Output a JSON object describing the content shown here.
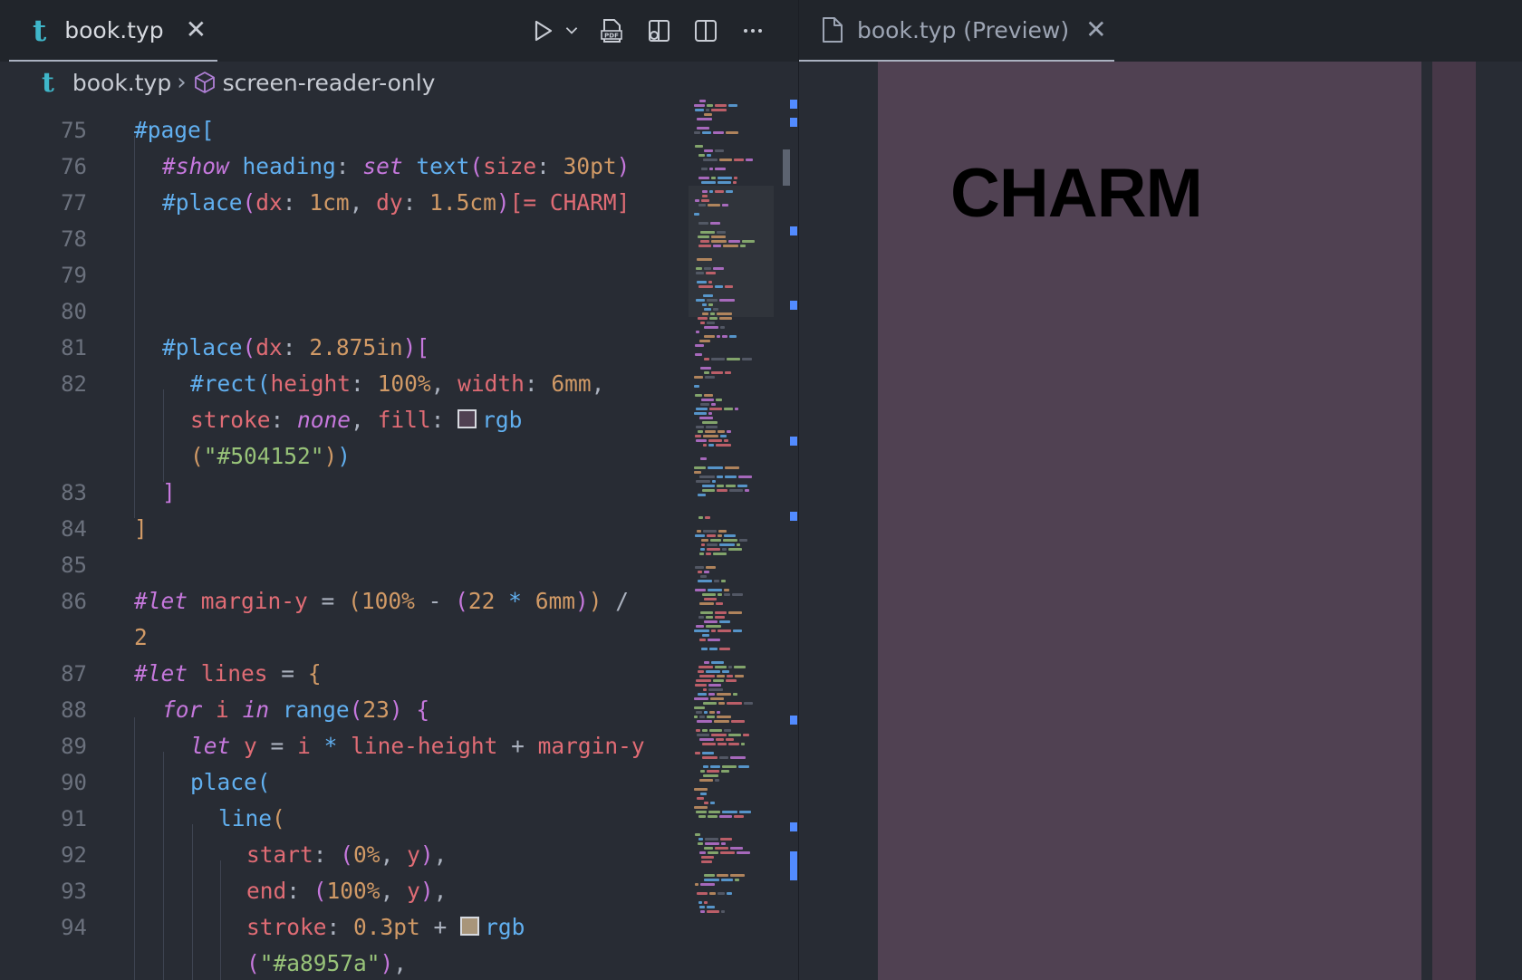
{
  "editor_tab": {
    "icon": "typst-t-icon",
    "logo": "t",
    "title": "book.typ"
  },
  "preview_tab": {
    "title": "book.typ (Preview)"
  },
  "breadcrumb": {
    "logo": "t",
    "file": "book.typ",
    "symbol": "screen-reader-only"
  },
  "toolbar": [
    "run-icon",
    "chevron-down-icon",
    "export-pdf-icon",
    "open-preview-icon",
    "split-editor-icon",
    "more-icon"
  ],
  "preview": {
    "heading_text": "CHARM",
    "page_color": "#504152"
  },
  "code_lines": [
    {
      "n": "75"
    },
    {
      "n": "76"
    },
    {
      "n": "77"
    },
    {
      "n": "78"
    },
    {
      "n": "79"
    },
    {
      "n": "80"
    },
    {
      "n": "81"
    },
    {
      "n": "82"
    },
    {
      "n": ""
    },
    {
      "n": ""
    },
    {
      "n": "83"
    },
    {
      "n": "84"
    },
    {
      "n": "85"
    },
    {
      "n": "86"
    },
    {
      "n": ""
    },
    {
      "n": "87"
    },
    {
      "n": "88"
    },
    {
      "n": "89"
    },
    {
      "n": "90"
    },
    {
      "n": "91"
    },
    {
      "n": "92"
    },
    {
      "n": "93"
    },
    {
      "n": "94"
    },
    {
      "n": ""
    }
  ],
  "code_text": {
    "l75": "#page[",
    "l76a": "#show",
    "l76b": "heading",
    "l76c": "set",
    "l76d": "text",
    "l76e": "size",
    "l76f": "30pt",
    "l77a": "#place",
    "l77b": "dx",
    "l77c": "1cm",
    "l77d": "dy",
    "l77e": "1.5cm",
    "l77f": "[= CHARM]",
    "l81a": "#place",
    "l81b": "dx",
    "l81c": "2.875in",
    "l82a": "#rect",
    "l82b": "height",
    "l82c": "100%",
    "l82d": "width",
    "l82e": "6mm",
    "l82f": "stroke",
    "l82g": "none",
    "l82h": "fill",
    "l82i": "rgb",
    "l82j": "\"#504152\"",
    "l86a": "#let",
    "l86b": "margin-y",
    "l86c": "100%",
    "l86d": "22",
    "l86e": "6mm",
    "l86f": "2",
    "l87a": "#let",
    "l87b": "lines",
    "l88a": "for",
    "l88b": "i",
    "l88c": "in",
    "l88d": "range",
    "l88e": "23",
    "l89a": "let",
    "l89b": "y",
    "l89c": "i",
    "l89d": "line-height",
    "l89e": "margin-y",
    "l90": "place",
    "l91": "line",
    "l92a": "start",
    "l92b": "0%",
    "l92c": "y",
    "l93a": "end",
    "l93b": "100%",
    "l93c": "y",
    "l94a": "stroke",
    "l94b": "0.3pt",
    "l94c": "rgb",
    "l94d": "\"#a8957a\""
  },
  "colors": {
    "swatch1": "#504152",
    "swatch2": "#a8957a",
    "accent": "#528bff"
  }
}
